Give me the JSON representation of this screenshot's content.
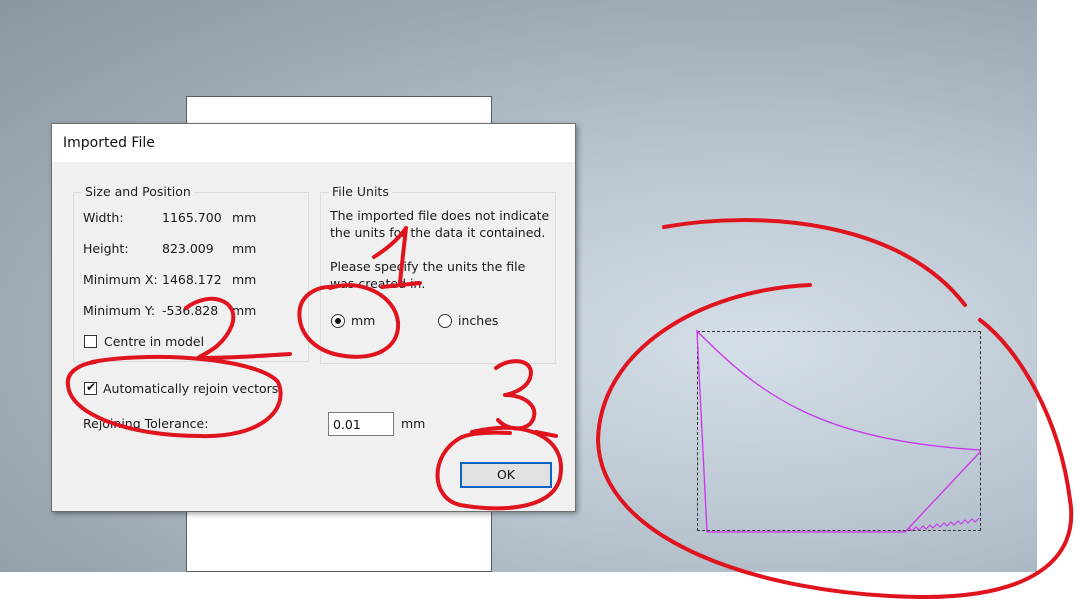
{
  "dialog": {
    "title": "Imported File",
    "size_position": {
      "group_label": "Size and Position",
      "rows": [
        {
          "label": "Width:",
          "value": "1165.700",
          "unit": "mm"
        },
        {
          "label": "Height:",
          "value": "823.009",
          "unit": "mm"
        },
        {
          "label": "Minimum X:",
          "value": "1468.172",
          "unit": "mm"
        },
        {
          "label": "Minimum Y:",
          "value": "-536.828",
          "unit": "mm"
        }
      ],
      "centre_in_model": {
        "label": "Centre in model",
        "checked": false
      }
    },
    "file_units": {
      "group_label": "File Units",
      "message": "The imported file does not indicate the units for the data it contained.",
      "prompt": "Please specify the units the file was created in.",
      "options": [
        {
          "label": "mm",
          "selected": true
        },
        {
          "label": "inches",
          "selected": false
        }
      ]
    },
    "rejoin": {
      "label": "Automatically rejoin vectors",
      "checked": true
    },
    "tolerance": {
      "label": "Rejoining Tolerance:",
      "value": "0.01",
      "unit": "mm"
    },
    "ok_label": "OK"
  },
  "colors": {
    "annotation": "#e0141e",
    "vector": "#cc33ee",
    "accent": "#0a64c8"
  }
}
